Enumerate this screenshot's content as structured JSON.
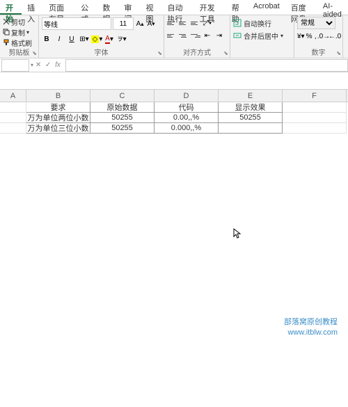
{
  "tabs": [
    "开始",
    "插入",
    "页面布局",
    "公式",
    "数据",
    "审阅",
    "视图",
    "自动执行",
    "开发工具",
    "帮助",
    "Acrobat",
    "百度网盘",
    "AI-aided"
  ],
  "active_tab": 0,
  "clipboard": {
    "cut": "剪切",
    "copy": "复制",
    "format": "格式刷",
    "label": "剪贴板"
  },
  "font": {
    "name": "等线",
    "size": "11",
    "label": "字体",
    "bold": "B",
    "italic": "I",
    "underline": "U"
  },
  "align": {
    "label": "对齐方式"
  },
  "wrap": {
    "auto": "自动换行",
    "merge": "合并后居中"
  },
  "number": {
    "select": "常规",
    "label": "数字",
    "percent": "%",
    "comma": ","
  },
  "sheet": {
    "cols": [
      "A",
      "B",
      "C",
      "D",
      "E",
      "F"
    ],
    "data": [
      [
        "要求",
        "原始数据",
        "代码",
        "显示效果"
      ],
      [
        "万为单位两位小数",
        "50255",
        "0.00,,%",
        "50255"
      ],
      [
        "万为单位三位小数",
        "50255",
        "0.000,,%",
        ""
      ]
    ]
  },
  "watermark": {
    "line1": "部落窝原创教程",
    "line2": "www.itblw.com"
  }
}
